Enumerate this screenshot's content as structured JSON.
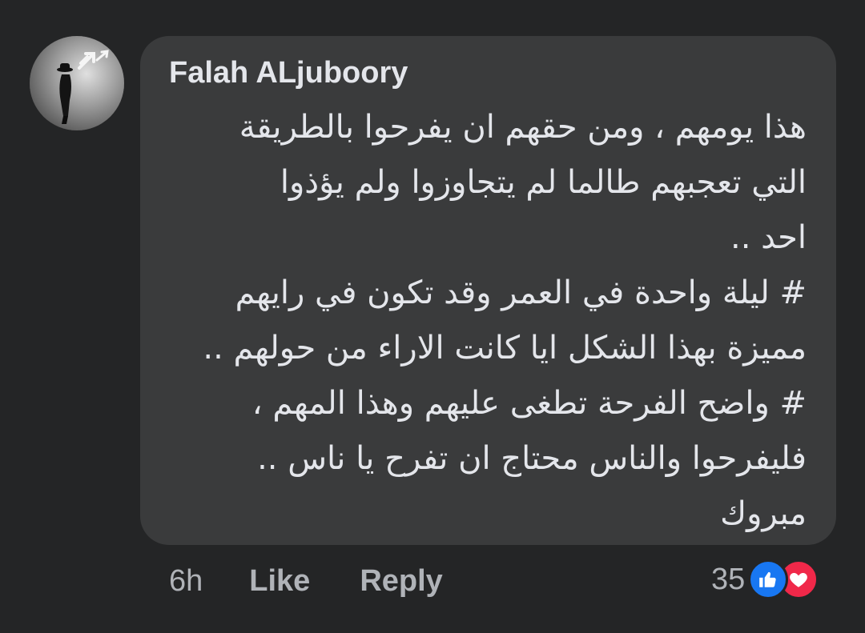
{
  "comment": {
    "author": "Falah ALjuboory",
    "lines": [
      "هذا يومهم ، ومن حقهم ان يفرحوا بالطريقة",
      "التي تعجبهم طالما لم يتجاوزوا ولم يؤذوا",
      "احد ..",
      "#  ليلة واحدة في العمر وقد تكون في رايهم",
      "مميزة بهذا الشكل ايا كانت الاراء من حولهم ..",
      "# واضح الفرحة تطغى عليهم وهذا المهم ،",
      "فليفرحوا والناس محتاج ان تفرح يا ناس ..",
      "مبروك"
    ]
  },
  "actions": {
    "time": "6h",
    "like_label": "Like",
    "reply_label": "Reply"
  },
  "reactions": {
    "count": "35",
    "icons": [
      "thumbs-up-icon",
      "heart-icon"
    ],
    "like_color": "#1877f2",
    "love_color": "#f02849"
  },
  "colors": {
    "background": "#242526",
    "bubble": "#3a3b3c",
    "primary_text": "#e4e6eb",
    "secondary_text": "#b0b3b8"
  }
}
